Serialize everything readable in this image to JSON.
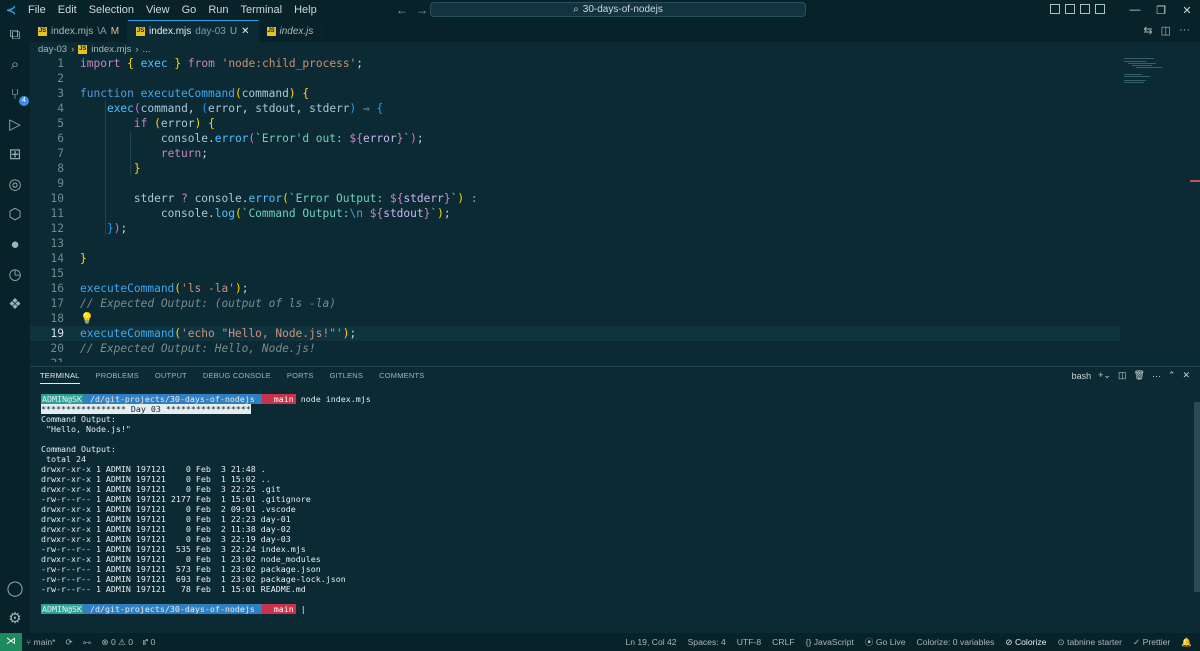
{
  "titlebar": {
    "menu": [
      "File",
      "Edit",
      "Selection",
      "View",
      "Go",
      "Run",
      "Terminal",
      "Help"
    ],
    "search_text": "30-days-of-nodejs"
  },
  "tabs": [
    {
      "label": "index.mjs",
      "tag": "\\A",
      "status": "M"
    },
    {
      "label": "index.mjs",
      "tag": "day-03",
      "status": "U"
    },
    {
      "label": "index.js"
    }
  ],
  "breadcrumb": {
    "folder": "day-03",
    "file": "index.mjs",
    "rest": "..."
  },
  "editor": {
    "lines": [
      "1",
      "2",
      "3",
      "4",
      "5",
      "6",
      "7",
      "8",
      "9",
      "10",
      "11",
      "12",
      "13",
      "14",
      "15",
      "16",
      "17",
      "18",
      "19",
      "20",
      "21"
    ]
  },
  "panel": {
    "tabs": [
      "TERMINAL",
      "PROBLEMS",
      "OUTPUT",
      "DEBUG CONSOLE",
      "PORTS",
      "GITLENS",
      "COMMENTS"
    ],
    "shell": "bash"
  },
  "terminal": {
    "prompt_user": "ADMIN@SK",
    "prompt_path": " /d/git-projects/30-days-of-nodejs ",
    "prompt_branch": "  main",
    "command": " node index.mjs",
    "banner": "***************** Day 03 *****************",
    "out1_label": "Command Output:",
    "out1_value": " \"Hello, Node.js!\"",
    "out2_label": "Command Output:",
    "out2_total": " total 24",
    "listing": [
      "drwxr-xr-x 1 ADMIN 197121    0 Feb  3 21:48 .",
      "drwxr-xr-x 1 ADMIN 197121    0 Feb  1 15:02 ..",
      "drwxr-xr-x 1 ADMIN 197121    0 Feb  3 22:25 .git",
      "-rw-r--r-- 1 ADMIN 197121 2177 Feb  1 15:01 .gitignore",
      "drwxr-xr-x 1 ADMIN 197121    0 Feb  2 09:01 .vscode",
      "drwxr-xr-x 1 ADMIN 197121    0 Feb  1 22:23 day-01",
      "drwxr-xr-x 1 ADMIN 197121    0 Feb  2 11:38 day-02",
      "drwxr-xr-x 1 ADMIN 197121    0 Feb  3 22:19 day-03",
      "-rw-r--r-- 1 ADMIN 197121  535 Feb  3 22:24 index.mjs",
      "drwxr-xr-x 1 ADMIN 197121    0 Feb  1 23:02 node_modules",
      "-rw-r--r-- 1 ADMIN 197121  573 Feb  1 23:02 package.json",
      "-rw-r--r-- 1 ADMIN 197121  693 Feb  1 23:02 package-lock.json",
      "-rw-r--r-- 1 ADMIN 197121   78 Feb  1 15:01 README.md"
    ]
  },
  "statusbar": {
    "branch": "main*",
    "errors": "0",
    "warnings": "0",
    "ports": "0",
    "position": "Ln 19, Col 42",
    "spaces": "Spaces: 4",
    "encoding": "UTF-8",
    "eol": "CRLF",
    "language": "JavaScript",
    "golive": "Go Live",
    "colorize_vars": "Colorize: 0 variables",
    "colorize": "Colorize",
    "tabnine": "tabnine starter",
    "prettier": "Prettier"
  },
  "colors": {
    "accent": "#2f9fe8",
    "background": "#0b2a33",
    "remote": "#1f8a5e"
  }
}
